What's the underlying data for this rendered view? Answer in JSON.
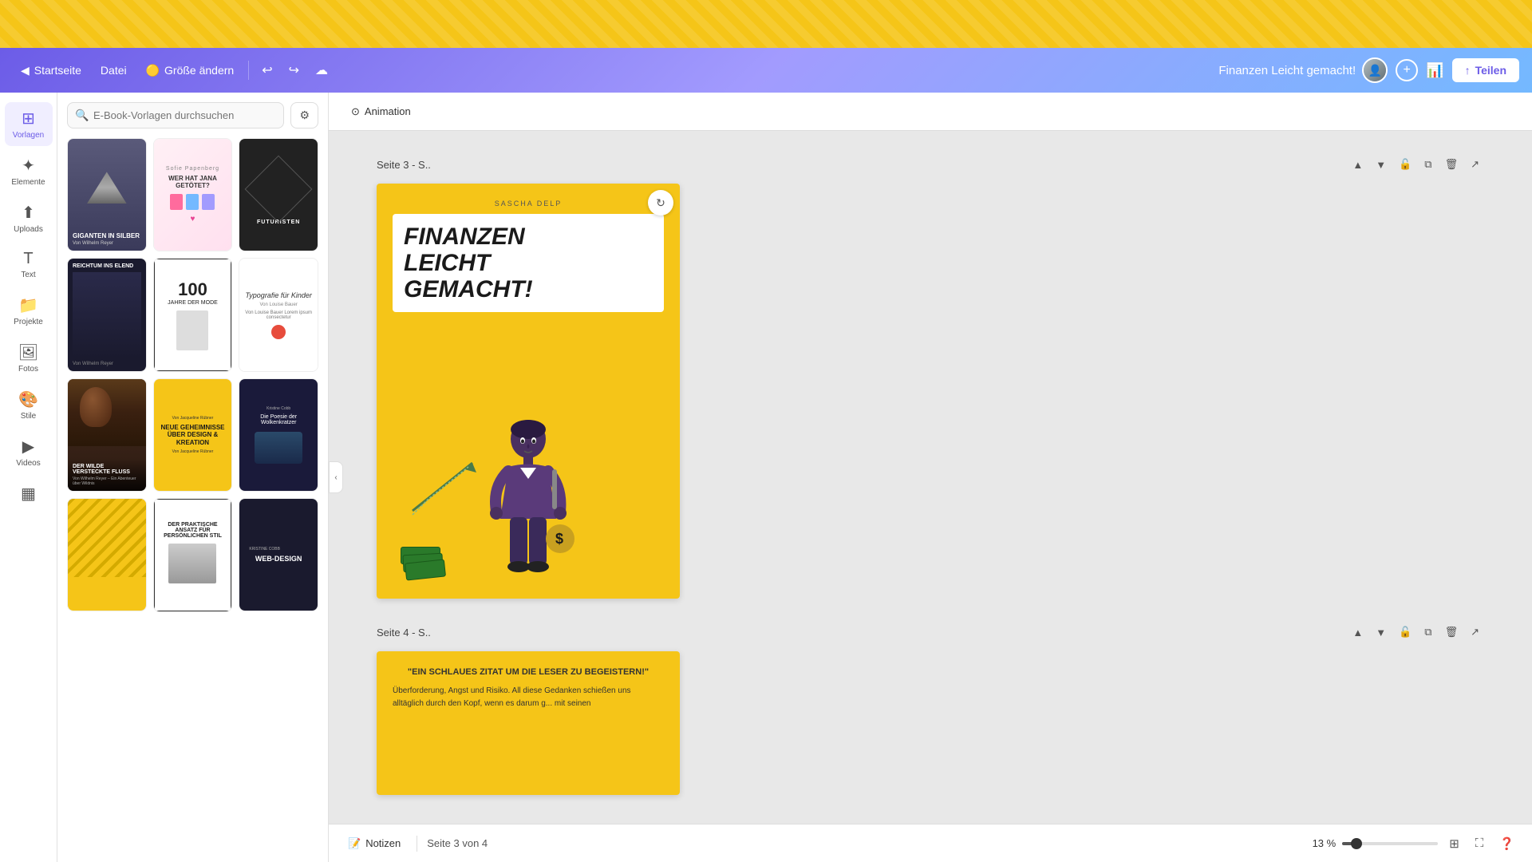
{
  "app": {
    "topBar": {
      "visible": true
    },
    "toolbar": {
      "home": "Startseite",
      "file": "Datei",
      "resize": "Größe ändern",
      "projectTitle": "Finanzen Leicht gemacht!",
      "shareLabel": "Teilen"
    },
    "sidebar": {
      "items": [
        {
          "id": "vorlagen",
          "label": "Vorlagen",
          "icon": "⊞",
          "active": true
        },
        {
          "id": "elemente",
          "label": "Elemente",
          "icon": "✦"
        },
        {
          "id": "uploads",
          "label": "Uploads",
          "icon": "⬆"
        },
        {
          "id": "text",
          "label": "Text",
          "icon": "T"
        },
        {
          "id": "projekte",
          "label": "Projekte",
          "icon": "📁"
        },
        {
          "id": "fotos",
          "label": "Fotos",
          "icon": "🖼"
        },
        {
          "id": "stile",
          "label": "Stile",
          "icon": "🎨"
        },
        {
          "id": "videos",
          "label": "Videos",
          "icon": "▶"
        },
        {
          "id": "muster",
          "label": "Muster",
          "icon": "▦"
        }
      ]
    },
    "templatesPanel": {
      "searchPlaceholder": "E-Book-Vorlagen durchsuchen",
      "templates": [
        {
          "id": "giganten",
          "title": "GIGANTEN IN SILBER",
          "type": "dark-mountain"
        },
        {
          "id": "jana",
          "title": "WER HAT JANA GETÖTET?",
          "type": "pink-manga"
        },
        {
          "id": "futuristen",
          "title": "FUTURISTEN",
          "type": "black-geometric"
        },
        {
          "id": "reichtum",
          "title": "REICHTUM INS ELEND",
          "type": "dark-navy"
        },
        {
          "id": "100jahre",
          "big": "100",
          "title": "JAHRE DER MODE",
          "type": "white-fashion"
        },
        {
          "id": "typografie",
          "title": "Typografie für Kinder",
          "type": "white-typo"
        },
        {
          "id": "wilder-fluss",
          "title": "DER WILDE VERSTECKTE FLUSS",
          "type": "dark-forest"
        },
        {
          "id": "neue-geheimnisse",
          "title": "NEUE GEHEIMNISSE ÜBER DESIGN & KREATION",
          "type": "yellow-design"
        },
        {
          "id": "poesie",
          "title": "Die Poesie der Wolkenkratzer",
          "type": "dark-city"
        },
        {
          "id": "yellow-stripes",
          "title": "",
          "type": "yellow-stripes"
        },
        {
          "id": "praktisch",
          "title": "DER PRAKTISCHE ANSATZ FÜR PERSÖNLICHEN STIL",
          "type": "white-fashion2"
        },
        {
          "id": "webdesign",
          "title": "WEB-DESIGN",
          "type": "dark-web"
        }
      ]
    },
    "canvas": {
      "animationLabel": "Animation",
      "pages": [
        {
          "id": "page3",
          "label": "Seite 3 - S..",
          "author": "SASCHA DELP",
          "title": "FINANZEN\nLEICHT\nGEMACHT!",
          "type": "finance-cover"
        },
        {
          "id": "page4",
          "label": "Seite 4 - S..",
          "quote": "\"EIN SCHLAUES ZITAT UM DIE LESER ZU BEGEISTERN!\"",
          "body": "Überforderung, Angst und Risiko. All diese Gedanken schießen uns alltäglich durch den Kopf, wenn es darum g... mit seinen",
          "type": "quote-page"
        }
      ]
    },
    "bottomBar": {
      "notesLabel": "Notizen",
      "pageInfo": "Seite 3 von 4",
      "zoomLevel": "13 %"
    }
  }
}
